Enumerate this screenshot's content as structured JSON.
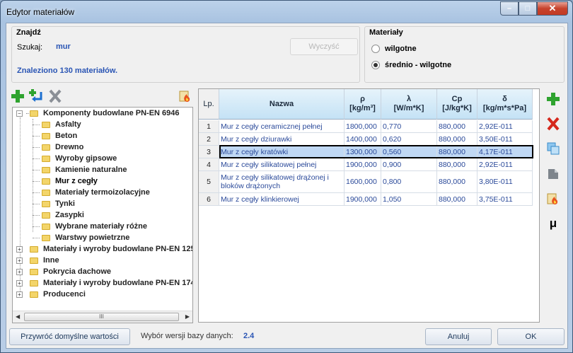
{
  "window": {
    "title": "Edytor materiałów",
    "min": "–",
    "max": "□",
    "close": "✕"
  },
  "search": {
    "group_title": "Znajdź",
    "label": "Szukaj:",
    "value": "mur",
    "clear_button": "Wyczyść",
    "result": "Znaleziono 130 materiałów."
  },
  "materials_group": {
    "title": "Materiały",
    "options": [
      "wilgotne",
      "średnio - wilgotne"
    ],
    "selected_index": 1
  },
  "toolbar_left": {
    "add": "add-icon",
    "import": "import-icon",
    "delete": "delete-icon",
    "fire": "fire-icon"
  },
  "tree": {
    "items": [
      {
        "label": "Komponenty budowlane PN-EN 6946",
        "expander": "−"
      },
      {
        "label": "Asfalty"
      },
      {
        "label": "Beton"
      },
      {
        "label": "Drewno"
      },
      {
        "label": "Wyroby gipsowe"
      },
      {
        "label": "Kamienie naturalne"
      },
      {
        "label": "Mur z cegły"
      },
      {
        "label": "Materiały termoizolacyjne"
      },
      {
        "label": "Tynki"
      },
      {
        "label": "Zasypki"
      },
      {
        "label": "Wybrane materiały różne"
      },
      {
        "label": "Warstwy powietrzne"
      },
      {
        "label": "Materiały i wyroby budowlane PN-EN 125",
        "expander": "+"
      },
      {
        "label": "Inne",
        "expander": "+"
      },
      {
        "label": "Pokrycia dachowe",
        "expander": "+"
      },
      {
        "label": "Materiały i wyroby budowlane PN-EN 174",
        "expander": "+"
      },
      {
        "label": "Producenci",
        "expander": "+"
      }
    ],
    "scroll_left": "◀",
    "scroll_right": "▶",
    "thumb": "III"
  },
  "table": {
    "columns": [
      {
        "key": "lp",
        "label": "Lp.",
        "unit": ""
      },
      {
        "key": "nazwa",
        "label": "Nazwa",
        "unit": ""
      },
      {
        "key": "rho",
        "label": "ρ",
        "unit": "[kg/m³]"
      },
      {
        "key": "lambda",
        "label": "λ",
        "unit": "[W/m*K]"
      },
      {
        "key": "cp",
        "label": "Cp",
        "unit": "[J/kg*K]"
      },
      {
        "key": "delta",
        "label": "δ",
        "unit": "[kg/m*s*Pa]"
      }
    ],
    "rows": [
      {
        "lp": "1",
        "nazwa": "Mur z cegły ceramicznej pełnej",
        "rho": "1800,000",
        "lambda": "0,770",
        "cp": "880,000",
        "delta": "2,92E-011"
      },
      {
        "lp": "2",
        "nazwa": "Mur z cegły dziurawki",
        "rho": "1400,000",
        "lambda": "0,620",
        "cp": "880,000",
        "delta": "3,50E-011"
      },
      {
        "lp": "3",
        "nazwa": "Mur z cegły kratówki",
        "rho": "1300,000",
        "lambda": "0,560",
        "cp": "880,000",
        "delta": "4,17E-011"
      },
      {
        "lp": "4",
        "nazwa": "Mur z cegły silikatowej pełnej",
        "rho": "1900,000",
        "lambda": "0,900",
        "cp": "880,000",
        "delta": "2,92E-011"
      },
      {
        "lp": "5",
        "nazwa": "Mur z cegły silikatowej drążonej i bloków drążonych",
        "rho": "1600,000",
        "lambda": "0,800",
        "cp": "880,000",
        "delta": "3,80E-011"
      },
      {
        "lp": "6",
        "nazwa": "Mur z cegły klinkierowej",
        "rho": "1900,000",
        "lambda": "1,050",
        "cp": "880,000",
        "delta": "3,75E-011"
      }
    ],
    "selected_row": 2
  },
  "toolbar_right": {
    "mu_label": "μ"
  },
  "footer": {
    "restore_button": "Przywróć domyślne wartości",
    "version_label": "Wybór wersji bazy danych:",
    "version_value": "2.4",
    "cancel_button": "Anuluj",
    "ok_button": "OK"
  },
  "colors": {
    "accent_text": "#2a55b4",
    "selection": "#c0d8f4",
    "header": "#c4e2f5"
  }
}
